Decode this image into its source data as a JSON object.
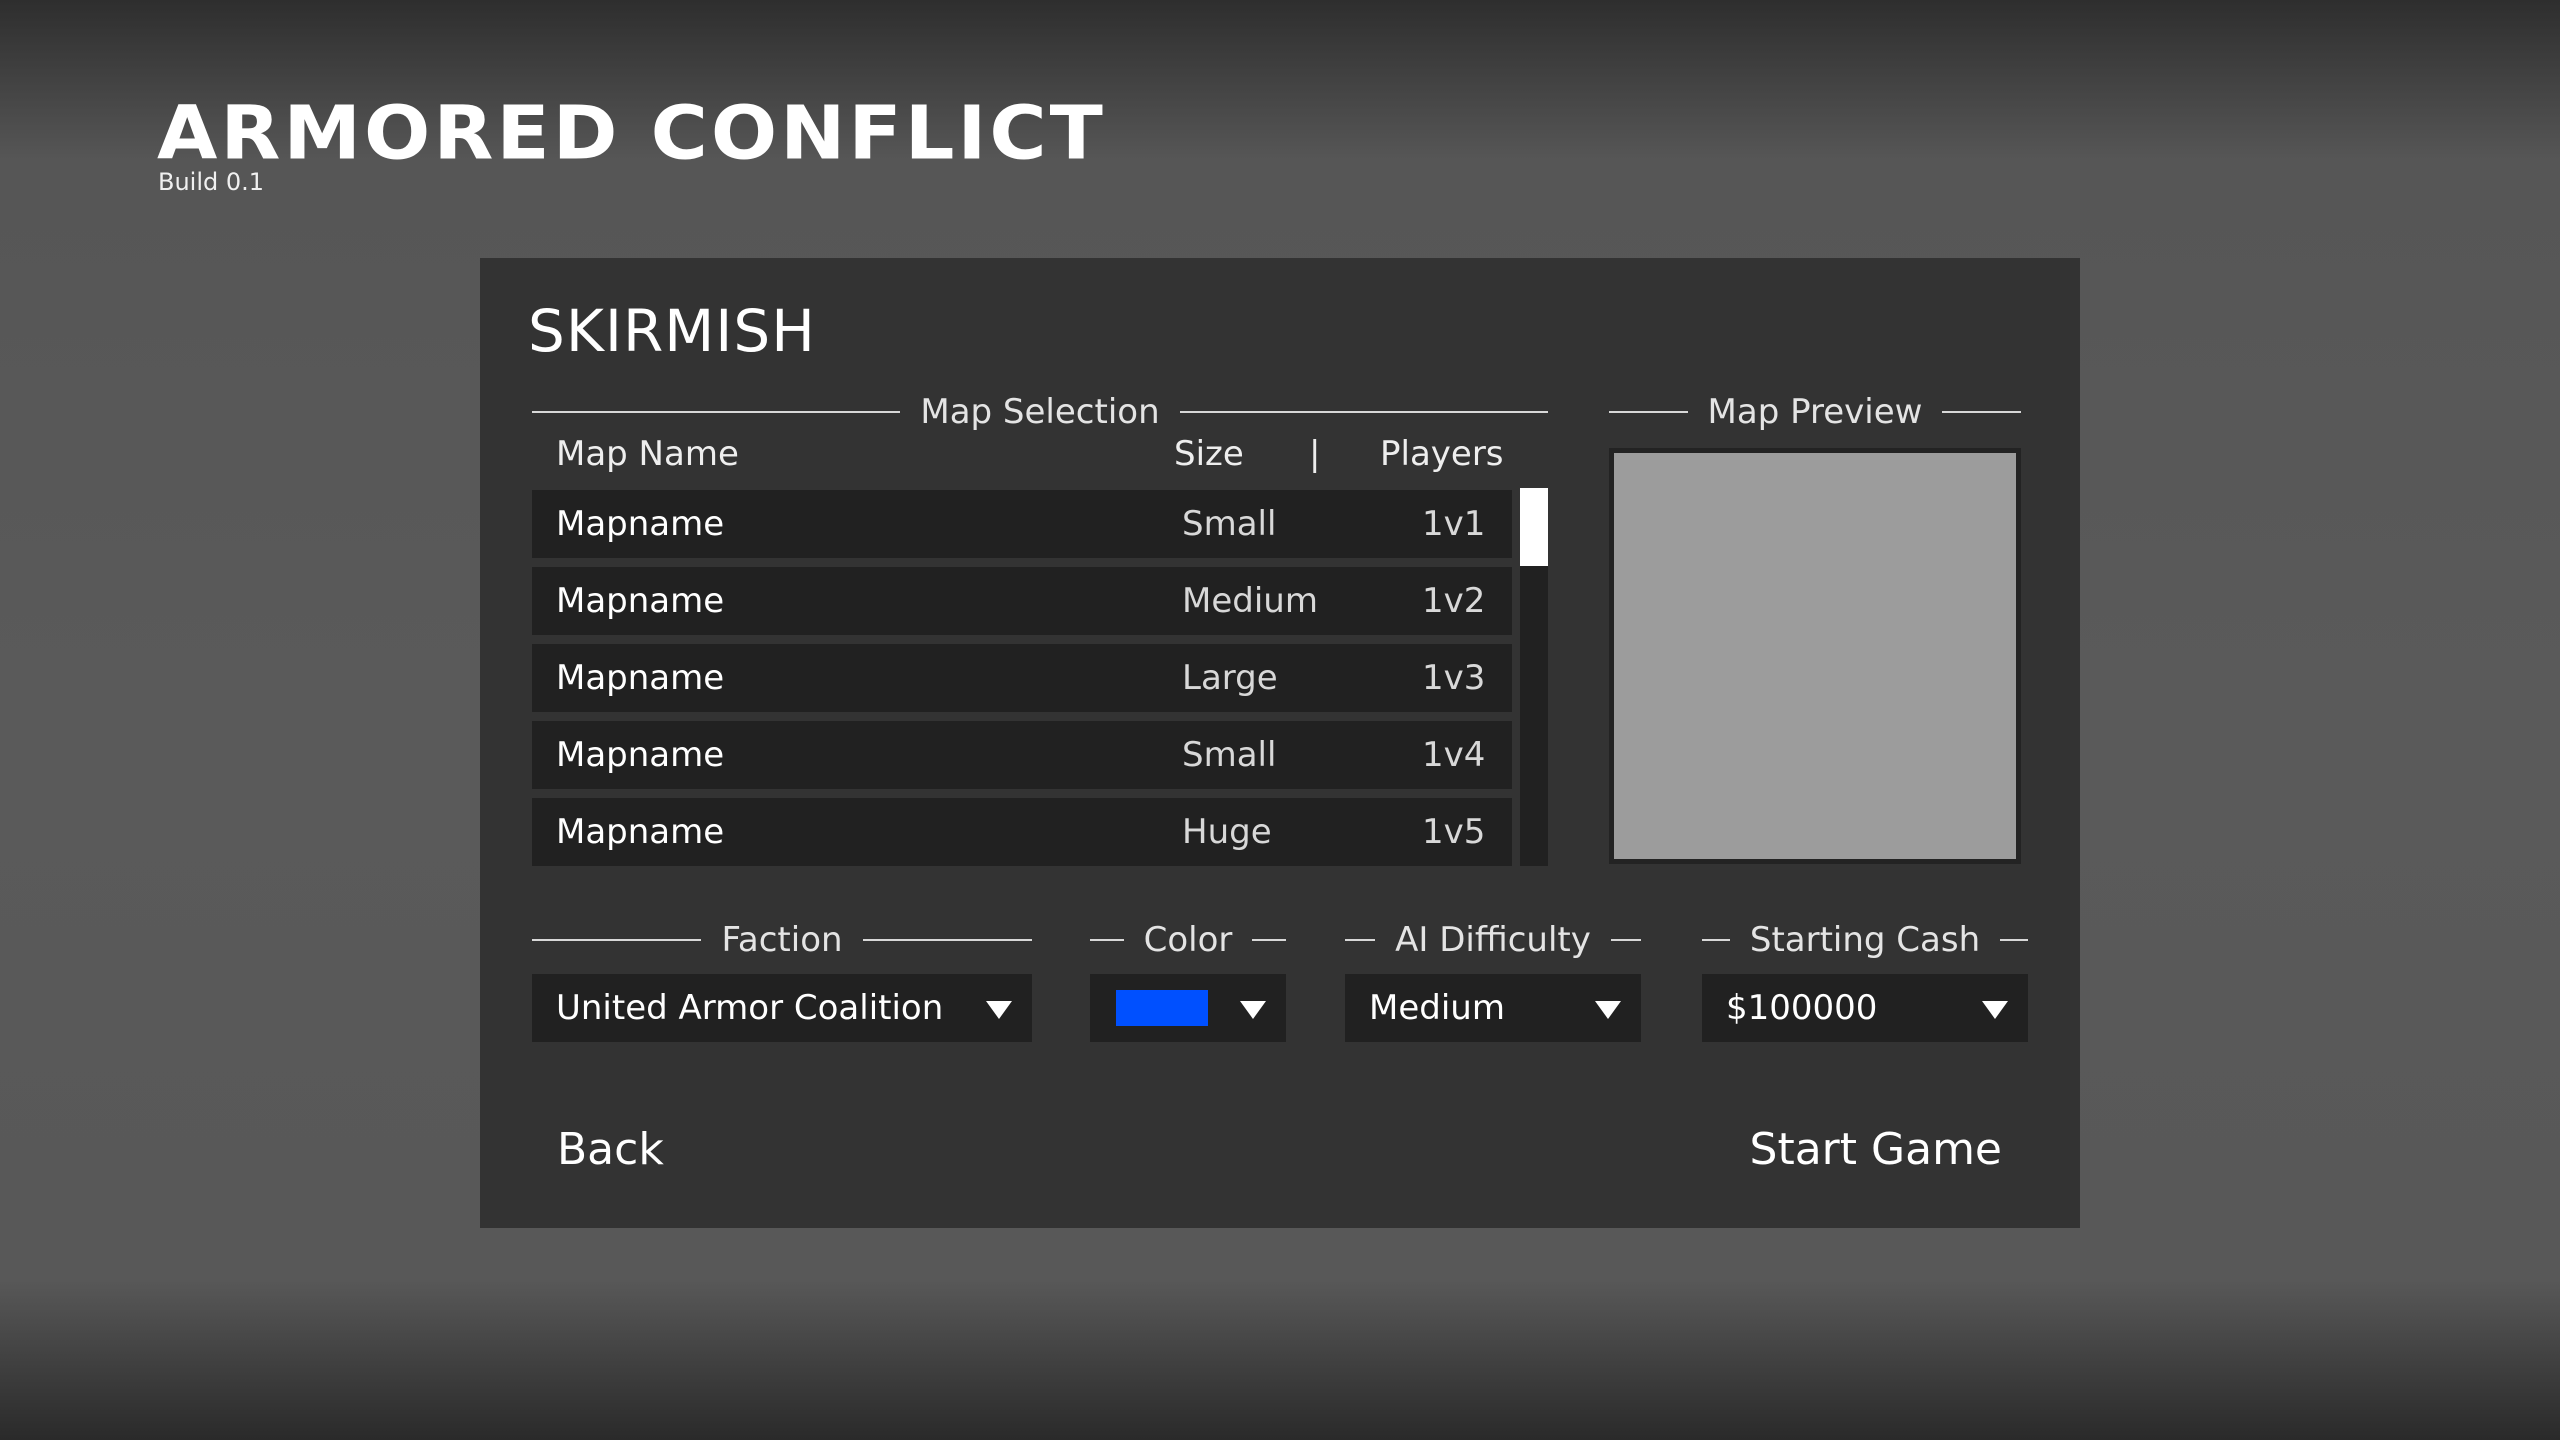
{
  "header": {
    "game_title": "ARMORED CONFLICT",
    "build": "Build 0.1"
  },
  "panel": {
    "title": "SKIRMISH"
  },
  "map_selection": {
    "label": "Map Selection",
    "columns": {
      "name": "Map Name",
      "size": "Size",
      "separator": "|",
      "players": "Players"
    },
    "maps": [
      {
        "name": "Mapname",
        "size": "Small",
        "players": "1v1"
      },
      {
        "name": "Mapname",
        "size": "Medium",
        "players": "1v2"
      },
      {
        "name": "Mapname",
        "size": "Large",
        "players": "1v3"
      },
      {
        "name": "Mapname",
        "size": "Small",
        "players": "1v4"
      },
      {
        "name": "Mapname",
        "size": "Huge",
        "players": "1v5"
      }
    ]
  },
  "map_preview": {
    "label": "Map Preview"
  },
  "settings": {
    "faction": {
      "label": "Faction",
      "value": "United Armor Coalition"
    },
    "color": {
      "label": "Color",
      "value": "#0050ff"
    },
    "ai_difficulty": {
      "label": "AI Difficulty",
      "value": "Medium"
    },
    "starting_cash": {
      "label": "Starting Cash",
      "value": "$100000"
    }
  },
  "actions": {
    "back": "Back",
    "start": "Start Game"
  },
  "icons": {
    "dropdown": "triangle-down-icon"
  }
}
